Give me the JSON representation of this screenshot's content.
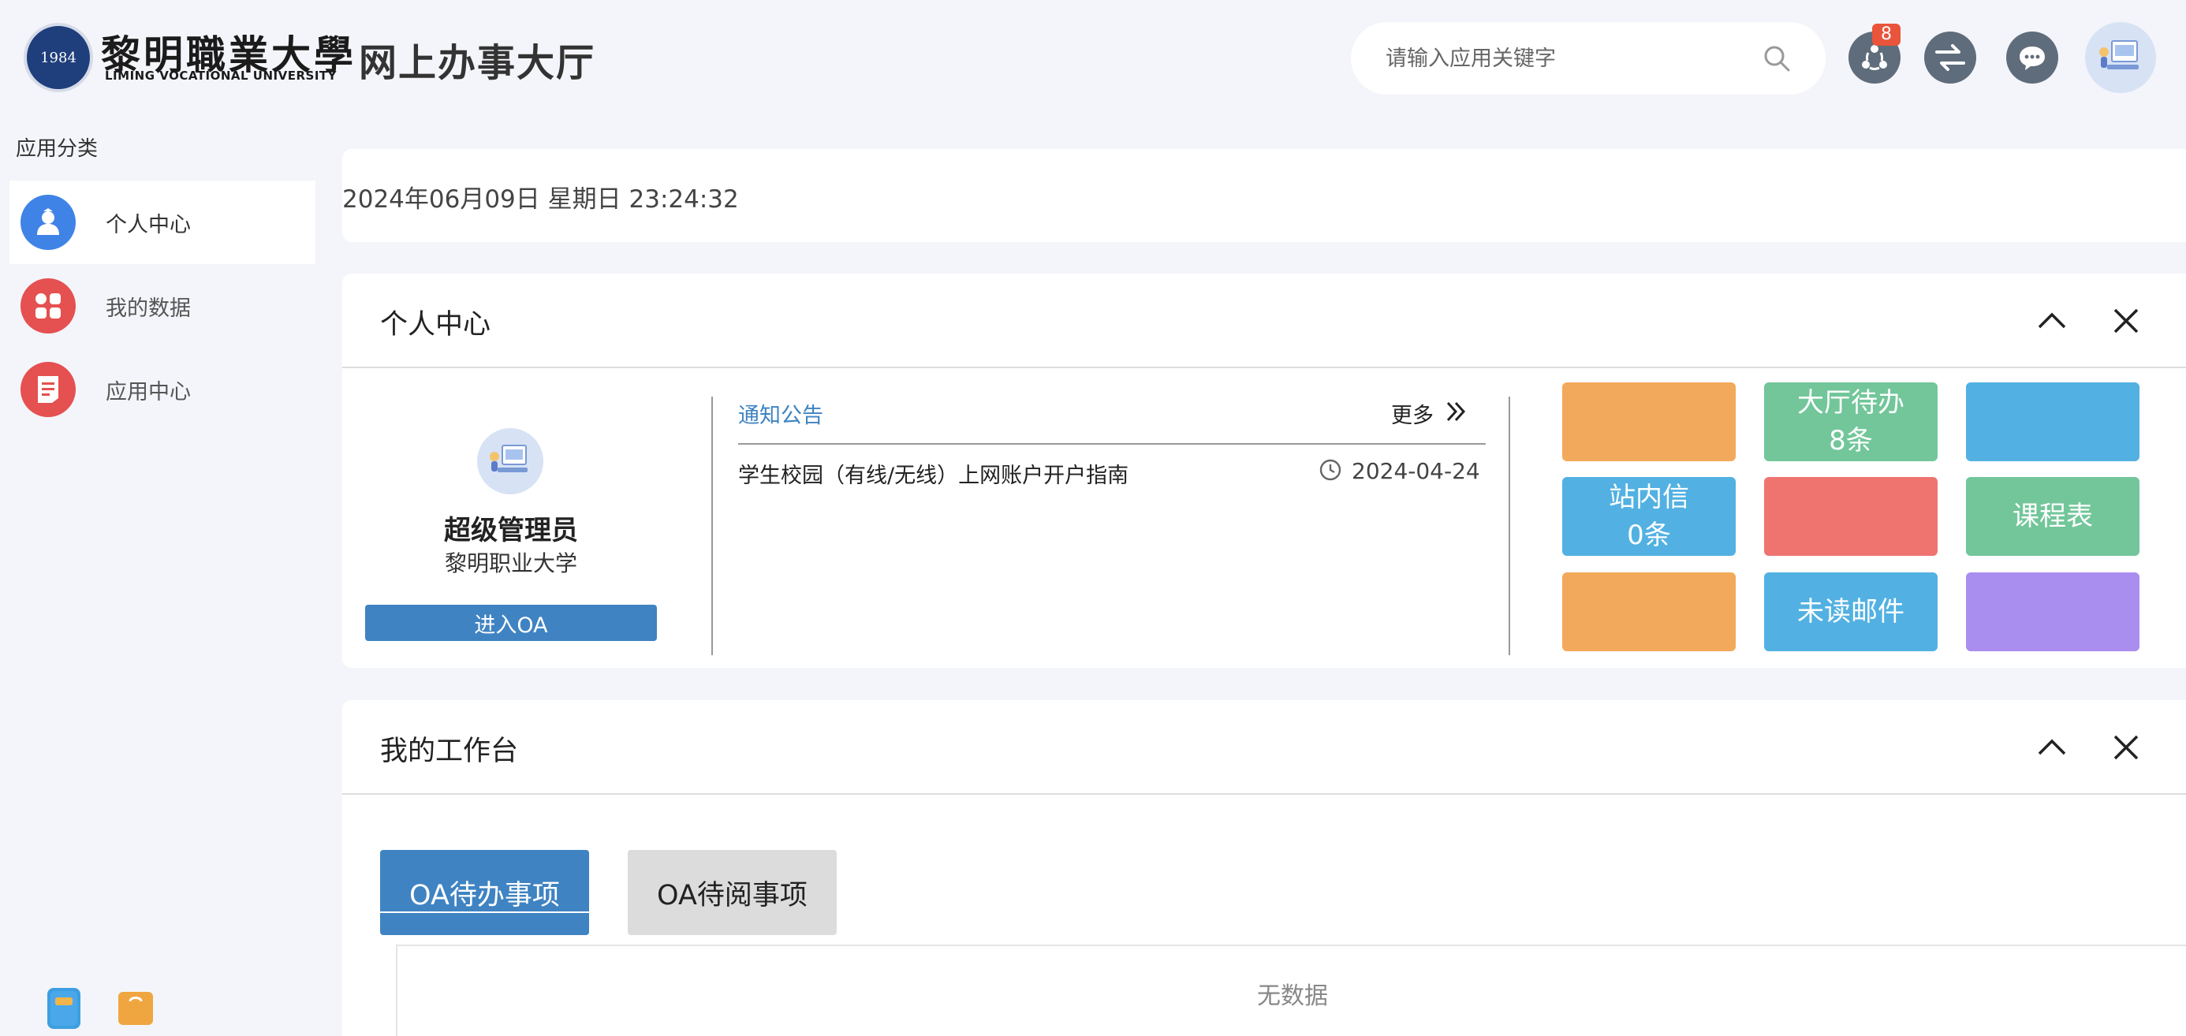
{
  "header": {
    "logo_cn": "黎明職業大學",
    "logo_en": "LIMING VOCATIONAL UNIVERSITY",
    "logo_year": "1984",
    "portal_title": "网上办事大厅",
    "search_placeholder": "请输入应用关键字",
    "notification_count": "8"
  },
  "sidebar": {
    "title": "应用分类",
    "items": [
      {
        "label": "个人中心",
        "icon": "user-icon",
        "color": "#3f83e6"
      },
      {
        "label": "我的数据",
        "icon": "grid-icon",
        "color": "#e55050"
      },
      {
        "label": "应用中心",
        "icon": "document-icon",
        "color": "#e55050"
      }
    ]
  },
  "datetime": "2024年06月09日 星期日 23:24:32",
  "personal_center": {
    "title": "个人中心",
    "user_name": "超级管理员",
    "user_school": "黎明职业大学",
    "enter_oa_label": "进入OA",
    "notice_tab": "通知公告",
    "more_label": "更多",
    "notices": [
      {
        "title": "学生校园（有线/无线）上网账户开户指南",
        "date": "2024-04-24"
      }
    ],
    "tiles": [
      {
        "label": "",
        "color": "#f3a95b"
      },
      {
        "label": "大厅待办\n8条",
        "color": "#72c69a"
      },
      {
        "label": "",
        "color": "#52b1e2"
      },
      {
        "label": "站内信\n0条",
        "color": "#52b1e2"
      },
      {
        "label": "",
        "color": "#ef7470"
      },
      {
        "label": "课程表",
        "color": "#72c69a"
      },
      {
        "label": "",
        "color": "#f3a95b"
      },
      {
        "label": "未读邮件",
        "color": "#52b1e2"
      },
      {
        "label": "",
        "color": "#a98ef0"
      }
    ]
  },
  "workbench": {
    "title": "我的工作台",
    "tabs": [
      "OA待办事项",
      "OA待阅事项"
    ],
    "empty_text": "无数据"
  }
}
